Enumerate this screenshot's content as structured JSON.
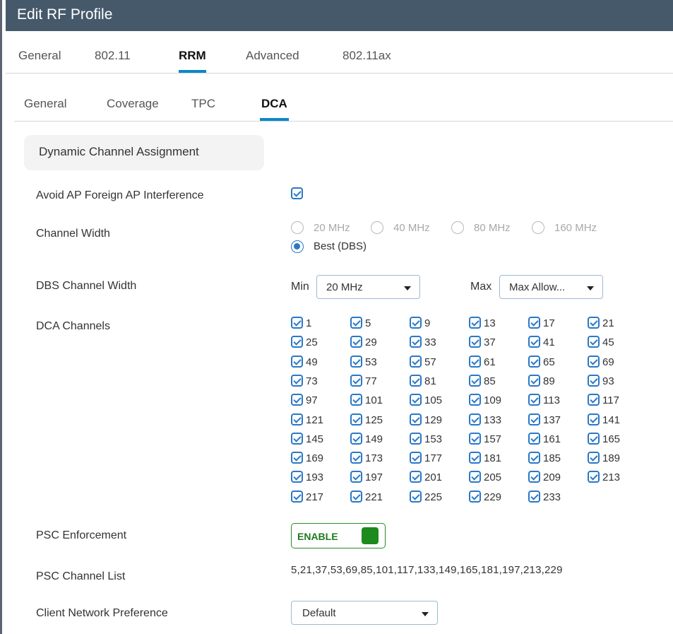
{
  "dialog": {
    "title": "Edit RF Profile"
  },
  "top_tabs": [
    {
      "label": "General"
    },
    {
      "label": "802.11"
    },
    {
      "label": "RRM",
      "active": true
    },
    {
      "label": "Advanced"
    },
    {
      "label": "802.11ax"
    }
  ],
  "sub_tabs": [
    {
      "label": "General"
    },
    {
      "label": "Coverage"
    },
    {
      "label": "TPC"
    },
    {
      "label": "DCA",
      "active": true
    }
  ],
  "section": {
    "title": "Dynamic Channel Assignment"
  },
  "fields": {
    "avoid_foreign": {
      "label": "Avoid AP Foreign AP Interference",
      "checked": true
    },
    "channel_width": {
      "label": "Channel Width",
      "options": [
        "20 MHz",
        "40 MHz",
        "80 MHz",
        "160 MHz",
        "Best (DBS)"
      ],
      "selected": "Best (DBS)"
    },
    "dbs_width": {
      "label": "DBS Channel Width",
      "min_label": "Min",
      "min_value": "20 MHz",
      "max_label": "Max",
      "max_value": "Max Allow..."
    },
    "dca_channels": {
      "label": "DCA Channels",
      "channels": [
        "1",
        "5",
        "9",
        "13",
        "17",
        "21",
        "25",
        "29",
        "33",
        "37",
        "41",
        "45",
        "49",
        "53",
        "57",
        "61",
        "65",
        "69",
        "73",
        "77",
        "81",
        "85",
        "89",
        "93",
        "97",
        "101",
        "105",
        "109",
        "113",
        "117",
        "121",
        "125",
        "129",
        "133",
        "137",
        "141",
        "145",
        "149",
        "153",
        "157",
        "161",
        "165",
        "169",
        "173",
        "177",
        "181",
        "185",
        "189",
        "193",
        "197",
        "201",
        "205",
        "209",
        "213",
        "217",
        "221",
        "225",
        "229",
        "233"
      ],
      "all_checked": true
    },
    "psc_enforcement": {
      "label": "PSC Enforcement",
      "state": "ENABLE"
    },
    "psc_channel_list": {
      "label": "PSC Channel List",
      "value": "5,21,37,53,69,85,101,117,133,149,165,181,197,213,229"
    },
    "client_network_pref": {
      "label": "Client Network Preference",
      "value": "Default"
    }
  },
  "colors": {
    "titlebar": "#46596b",
    "accent": "#0a88c8",
    "checkbox": "#2a78c7",
    "enable_green": "#1c8a1c"
  }
}
